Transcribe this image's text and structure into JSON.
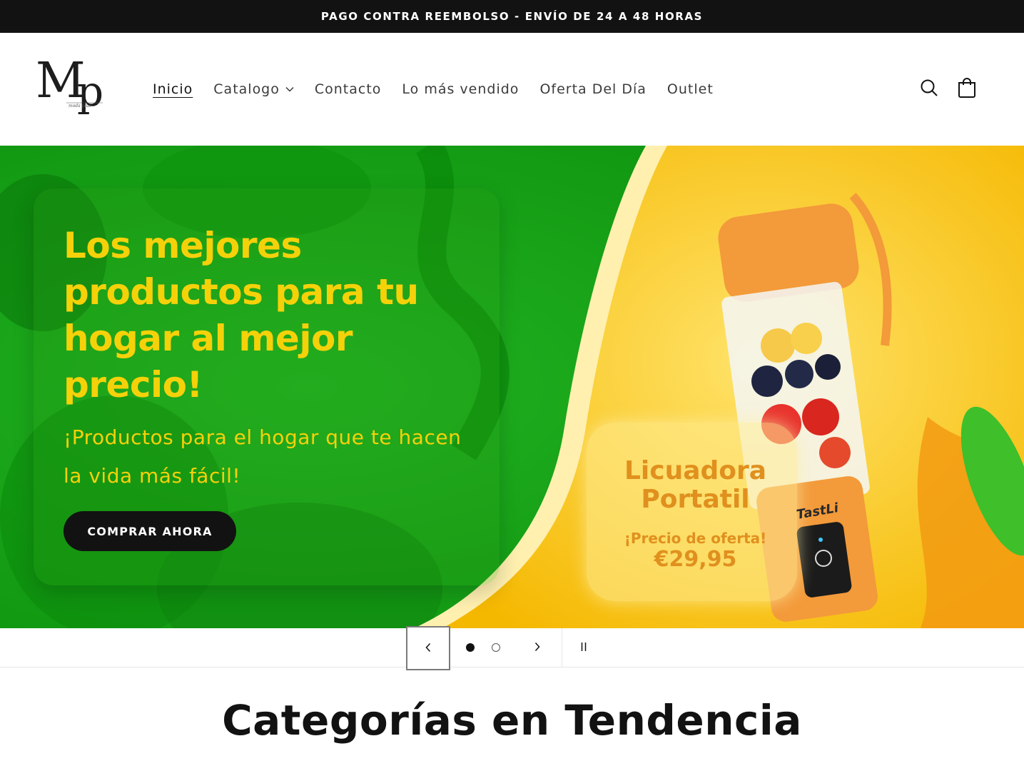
{
  "announcement": {
    "text": "PAGO CONTRA REEMBOLSO - ENVÍO DE 24 A 48 HORAS"
  },
  "header": {
    "logo_text": "Mp",
    "nav": [
      {
        "label": "Inicio",
        "active": true
      },
      {
        "label": "Catalogo",
        "has_dropdown": true
      },
      {
        "label": "Contacto"
      },
      {
        "label": "Lo más vendido"
      },
      {
        "label": "Oferta Del Día"
      },
      {
        "label": "Outlet"
      }
    ],
    "icons": [
      "search-icon",
      "cart-icon"
    ]
  },
  "hero": {
    "title": "Los mejores productos para tu hogar al mejor precio!",
    "subtitle": "¡Productos para el hogar que te hacen la vida más fácil!",
    "button_label": "COMPRAR AHORA",
    "offer": {
      "name_line1": "Licuadora",
      "name_line2": "Portatil",
      "label": "¡Precio de oferta!",
      "price": "€29,95",
      "brand": "TastLi"
    }
  },
  "slider": {
    "prev_icon": "chevron-left-icon",
    "next_icon": "chevron-right-icon",
    "pause_icon": "pause-icon",
    "slide_count": 2,
    "active_slide": 1
  },
  "categories": {
    "title": "Categorías en Tendencia"
  },
  "colors": {
    "announcement_bg": "#121212",
    "hero_green": "#16a016",
    "hero_yellow": "#f5c400",
    "headline_yellow": "#f5d10a",
    "offer_orange": "#e0901e",
    "button_bg": "#121212"
  }
}
